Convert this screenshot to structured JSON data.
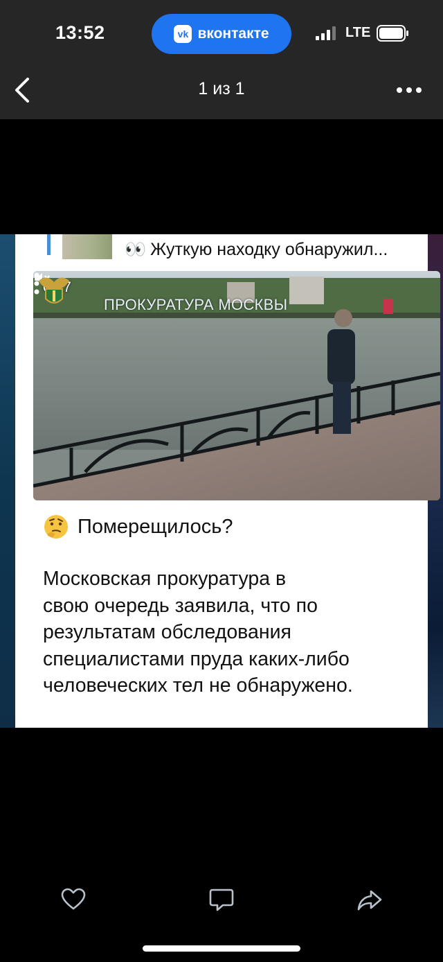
{
  "status_bar": {
    "time": "13:52",
    "app_pill_text": "вконтакте",
    "vk_logo_text": "vk",
    "network": "LTE"
  },
  "header": {
    "counter": "1 из 1",
    "back_icon": "chevron-left-icon",
    "more_icon": "ellipsis-icon"
  },
  "post": {
    "headline": "Жуткую находку обнаружил...",
    "headline_emoji": "👀",
    "video": {
      "time": "0:27",
      "watermark": "ПРОКУРАТУРА МОСКВЫ"
    },
    "question": "Померещилось?",
    "body": "Московская прокуратура в своюочередь заявила, что по результатам обследования специалистами пруда каких-либо человеческих тел не обнаружено.",
    "body_lines": [
      "Московская прокуратура в",
      "свою очередь заявила, что по",
      "результатам обследования",
      "специалистами пруда каких-либо",
      "человеческих тел не обнаружено."
    ]
  },
  "actions": {
    "like_icon": "heart-icon",
    "comment_icon": "comment-icon",
    "share_icon": "share-icon"
  },
  "colors": {
    "vk_blue": "#1f74f0",
    "topbar": "#262626",
    "background": "#000000"
  }
}
